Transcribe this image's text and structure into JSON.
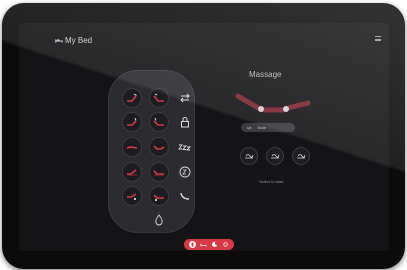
{
  "app": {
    "title": "My Bed"
  },
  "remote": {
    "buttons": [
      {
        "name": "head-raise-button",
        "icon": "head-up-icon"
      },
      {
        "name": "foot-raise-button",
        "icon": "foot-up-icon"
      },
      {
        "name": "sync-button",
        "icon": "sync-arrows-icon"
      },
      {
        "name": "head-lower-button",
        "icon": "head-down-icon"
      },
      {
        "name": "foot-lower-button",
        "icon": "foot-down-icon"
      },
      {
        "name": "lock-button",
        "icon": "lock-icon"
      },
      {
        "name": "preset-flat-button",
        "icon": "preset-flat-icon"
      },
      {
        "name": "preset-lounge-button",
        "icon": "preset-lounge-icon"
      },
      {
        "name": "zero-g-button",
        "icon": "zzz-icon"
      },
      {
        "name": "preset-tv-button",
        "icon": "preset-tv-icon"
      },
      {
        "name": "preset-read-button",
        "icon": "preset-read-icon"
      },
      {
        "name": "anti-snore-button",
        "icon": "anti-snore-icon"
      },
      {
        "name": "massage-head-button",
        "icon": "massage-head-icon"
      },
      {
        "name": "massage-foot-button",
        "icon": "massage-foot-icon"
      },
      {
        "name": "phone-button",
        "icon": "phone-icon"
      },
      {
        "name": "light-button",
        "icon": "drop-icon"
      }
    ]
  },
  "massage": {
    "title": "Massage",
    "intensity": {
      "left": "Up",
      "right": "Mode"
    },
    "hint": "Select to start"
  },
  "colors": {
    "accent": "#d73a45",
    "accent_dark": "#8e2430"
  }
}
